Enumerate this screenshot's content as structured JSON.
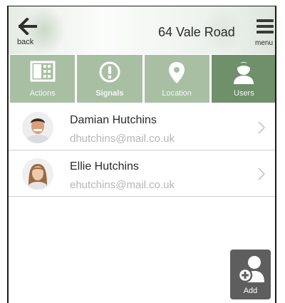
{
  "header": {
    "title": "64 Vale Road",
    "back_label": "back",
    "menu_label": "menu"
  },
  "tabs": [
    {
      "label": "Actions",
      "icon": "grid-icon",
      "active": false
    },
    {
      "label": "Signals",
      "icon": "alert-icon",
      "active": false
    },
    {
      "label": "Location",
      "icon": "location-pin-icon",
      "active": false
    },
    {
      "label": "Users",
      "icon": "user-icon",
      "active": true
    }
  ],
  "users": [
    {
      "name": "Damian Hutchins",
      "email": "dhutchins@mail.co.uk"
    },
    {
      "name": "Ellie Hutchins",
      "email": "ehutchins@mail.co.uk"
    }
  ],
  "add_button": {
    "label": "Add"
  },
  "colors": {
    "tab_inactive": "#a8bfa4",
    "tab_active": "#6f906b",
    "add_button": "#5e5e5e"
  }
}
